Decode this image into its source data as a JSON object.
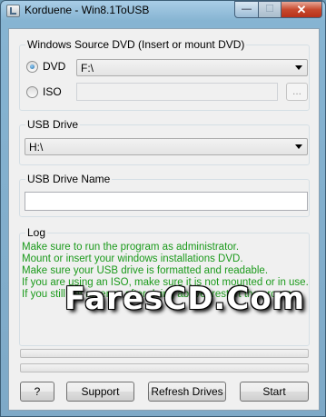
{
  "window": {
    "title": "Korduene - Win8.1ToUSB",
    "min_glyph": "—",
    "max_glyph": "☐",
    "close_glyph": "✕"
  },
  "source": {
    "group_title": "Windows Source DVD (Insert or mount DVD)",
    "dvd_label": "DVD",
    "dvd_value": "F:\\",
    "iso_label": "ISO",
    "iso_value": "",
    "browse_label": "..."
  },
  "usb": {
    "group_title": "USB Drive",
    "drive_value": "H:\\"
  },
  "usb_name": {
    "group_title": "USB Drive Name",
    "value": ""
  },
  "log": {
    "group_title": "Log",
    "lines": [
      "Make sure to run the program as administrator.",
      "Mount or insert your windows installations DVD.",
      "Make sure your USB drive is formatted and readable.",
      "If you are using an ISO, make sure it is not mounted or in use.",
      "If you still get an error after doing above, restart the program."
    ],
    "color": "#1b9a1b"
  },
  "watermark": "FaresCD.Com",
  "buttons": {
    "help": "?",
    "support": "Support",
    "refresh": "Refresh Drives",
    "start": "Start"
  }
}
